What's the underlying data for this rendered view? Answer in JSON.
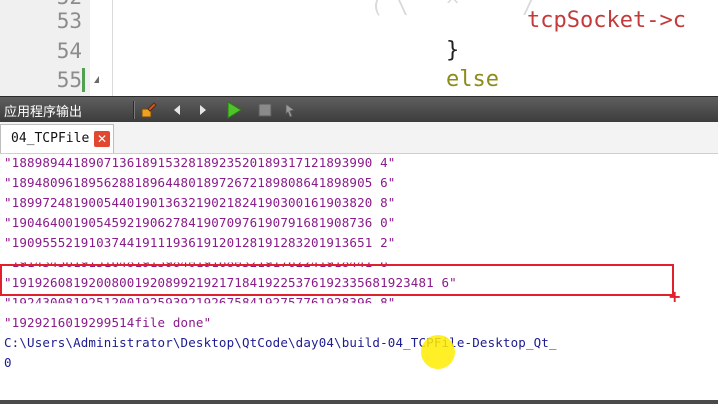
{
  "editor": {
    "lines": [
      {
        "number": "53",
        "code": "tcpSocket->c"
      },
      {
        "number": "54",
        "code": "}"
      },
      {
        "number": "55",
        "code": "else"
      }
    ],
    "top_partial_code": "tcpSocket->c"
  },
  "output_pane": {
    "title": "应用程序输出",
    "toolbar": {
      "run_icon": "run-icon",
      "stop_icon": "stop-icon",
      "attach_icon": "attach-debugger-icon",
      "prev_icon": "previous-icon",
      "next_icon": "next-icon",
      "clear_icon": "clear-icon"
    },
    "tab": {
      "label": "04_TCPFile",
      "close_label": "✕"
    },
    "lines": [
      "\"18898944189071361891532818923520189317121893990 4\"",
      "\"18948096189562881896448018972672189808641898905 6\"",
      "\"18997248190054401901363219021824190300161903820 8\"",
      "\"19046400190545921906278419070976190791681908736 0\"",
      "\"19095552191037441911193619120128191283201913651 2\"",
      "\"19143456191516481915984019168032191762241918441 6\"",
      "\"1919260819200800192089921921718419225376192335681923481 6\"",
      "\"19243008192512001925939219267584192757761928396 8\"",
      "\"1929216019299514file done\"",
      "C:\\Users\\Administrator\\Desktop\\QtCode\\day04\\build-04_TCPFile-Desktop_Qt_",
      "0"
    ]
  },
  "colors": {
    "output_text": "#8b1a8b",
    "path_text": "#1c1c8f",
    "highlight": "#e0202a",
    "tab_close": "#e2472f"
  }
}
